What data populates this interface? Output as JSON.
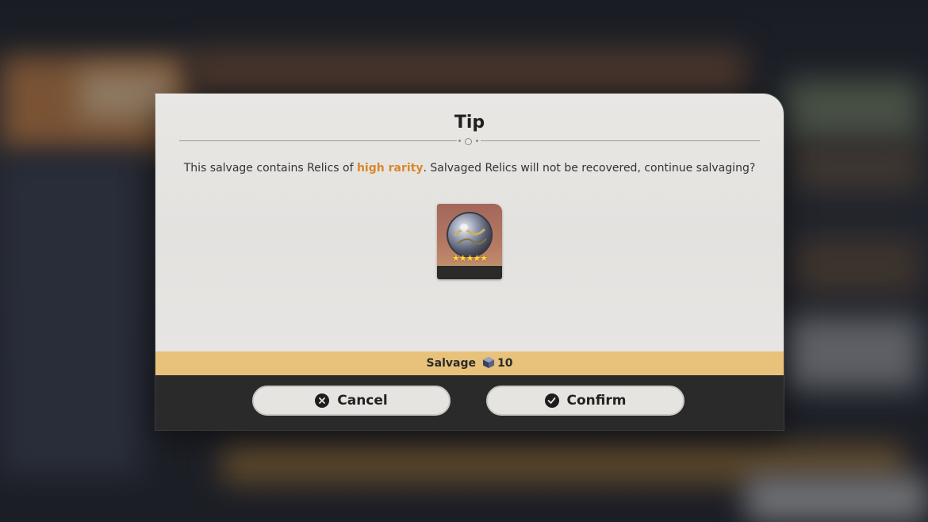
{
  "dialog": {
    "title": "Tip",
    "message_before": "This salvage contains Relics of ",
    "message_highlight": "high rarity",
    "message_after": ". Salvaged Relics will not be recovered, continue salvaging?",
    "highlight_color": "#d9882a"
  },
  "relic": {
    "icon": "relic-orb-icon",
    "rarity_stars": "★★★★★"
  },
  "salvage": {
    "label": "Salvage",
    "icon": "relic-remains-cube-icon",
    "amount": "10",
    "bar_color": "#e8c27a"
  },
  "buttons": {
    "cancel": {
      "label": "Cancel",
      "icon": "x-circle-icon"
    },
    "confirm": {
      "label": "Confirm",
      "icon": "check-circle-icon"
    }
  }
}
